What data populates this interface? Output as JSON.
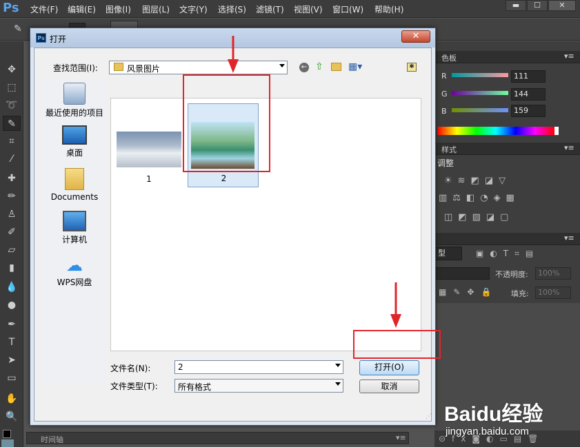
{
  "app": {
    "logo": "Ps",
    "menu": [
      "文件(F)",
      "编辑(E)",
      "图像(I)",
      "图层(L)",
      "文字(Y)",
      "选择(S)",
      "滤镜(T)",
      "视图(V)",
      "窗口(W)",
      "帮助(H)"
    ]
  },
  "panels": {
    "color_tab": "色板",
    "styles_tab": "样式",
    "adjust_title": "调整",
    "r_label": "R",
    "g_label": "G",
    "b_label": "B",
    "r_value": "111",
    "g_value": "144",
    "b_value": "159",
    "layers_kind": "型",
    "opacity_label": "不透明度:",
    "opacity_value": "100%",
    "fill_label": "填充:",
    "fill_value": "100%"
  },
  "timeline": {
    "label": "时间轴"
  },
  "dialog": {
    "title": "打开",
    "lookin_label": "查找范围(I):",
    "lookin_value": "风景图片",
    "places": [
      {
        "label": "最近使用的项目",
        "icon": "recent-icon"
      },
      {
        "label": "桌面",
        "icon": "desktop-icon"
      },
      {
        "label": "Documents",
        "icon": "folder-icon"
      },
      {
        "label": "计算机",
        "icon": "computer-icon"
      },
      {
        "label": "WPS网盘",
        "icon": "cloud-icon"
      }
    ],
    "files": [
      {
        "name": "1",
        "icon": "snow-mountain-thumbnail"
      },
      {
        "name": "2",
        "icon": "river-landscape-thumbnail",
        "selected": true
      }
    ],
    "filename_label": "文件名(N):",
    "filename_value": "2",
    "filetype_label": "文件类型(T):",
    "filetype_value": "所有格式",
    "open_button": "打开(O)",
    "cancel_button": "取消"
  },
  "watermark": {
    "brand": "Baidu经验",
    "url": "jingyan.baidu.com"
  },
  "colors": {
    "annotation_red": "#e0252a",
    "ps_blue": "#5aa4e8"
  }
}
